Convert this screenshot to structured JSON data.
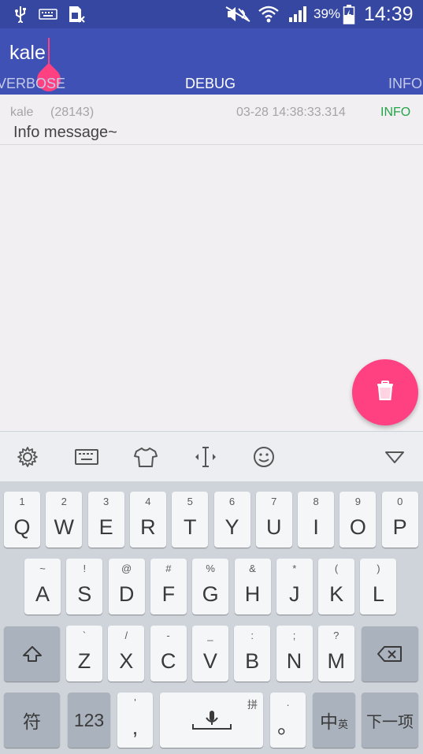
{
  "status_bar": {
    "battery_percent": "39%",
    "time": "14:39",
    "icons": [
      "usb-icon",
      "keyboard-icon",
      "sim-icon",
      "mute-icon",
      "wifi-icon",
      "signal-icon",
      "battery-icon"
    ]
  },
  "app_bar": {
    "search_value": "kale",
    "tabs": [
      "VERBOSE",
      "DEBUG",
      "INFO"
    ],
    "selected_tab": "DEBUG"
  },
  "log": {
    "entries": [
      {
        "tag": "kale",
        "pid": "(28143)",
        "time": "03-28 14:38:33.314",
        "level": "INFO",
        "message": "Info message~"
      }
    ],
    "level_color": "#23a449"
  },
  "fab": {
    "icon": "trash-icon",
    "color": "#ff4081"
  },
  "keyboard_toolbar": {
    "icons": [
      "gear-icon",
      "keyboard-icon",
      "shirt-icon",
      "cursor-move-icon",
      "emoji-icon",
      "collapse-icon"
    ]
  },
  "keyboard": {
    "row1": [
      {
        "main": "Q",
        "sub": "1"
      },
      {
        "main": "W",
        "sub": "2"
      },
      {
        "main": "E",
        "sub": "3"
      },
      {
        "main": "R",
        "sub": "4"
      },
      {
        "main": "T",
        "sub": "5"
      },
      {
        "main": "Y",
        "sub": "6"
      },
      {
        "main": "U",
        "sub": "7"
      },
      {
        "main": "I",
        "sub": "8"
      },
      {
        "main": "O",
        "sub": "9"
      },
      {
        "main": "P",
        "sub": "0"
      }
    ],
    "row2": [
      {
        "main": "A",
        "sub": "~"
      },
      {
        "main": "S",
        "sub": "!"
      },
      {
        "main": "D",
        "sub": "@"
      },
      {
        "main": "F",
        "sub": "#"
      },
      {
        "main": "G",
        "sub": "%"
      },
      {
        "main": "H",
        "sub": "&"
      },
      {
        "main": "J",
        "sub": "*"
      },
      {
        "main": "K",
        "sub": "("
      },
      {
        "main": "L",
        "sub": ")"
      }
    ],
    "row3": [
      {
        "main": "Z",
        "sub": "`"
      },
      {
        "main": "X",
        "sub": "/"
      },
      {
        "main": "C",
        "sub": "-"
      },
      {
        "main": "V",
        "sub": "_"
      },
      {
        "main": "B",
        "sub": ":"
      },
      {
        "main": "N",
        "sub": ";"
      },
      {
        "main": "M",
        "sub": "?"
      }
    ],
    "symbol_key": "符",
    "numbers_key": "123",
    "comma_key": {
      "main": ",",
      "sub": "'"
    },
    "space_key_sub": "拼",
    "period_key": {
      "main": "。",
      "sub": "."
    },
    "lang_key": {
      "main": "中",
      "sub": "英"
    },
    "next_key": "下一项"
  }
}
